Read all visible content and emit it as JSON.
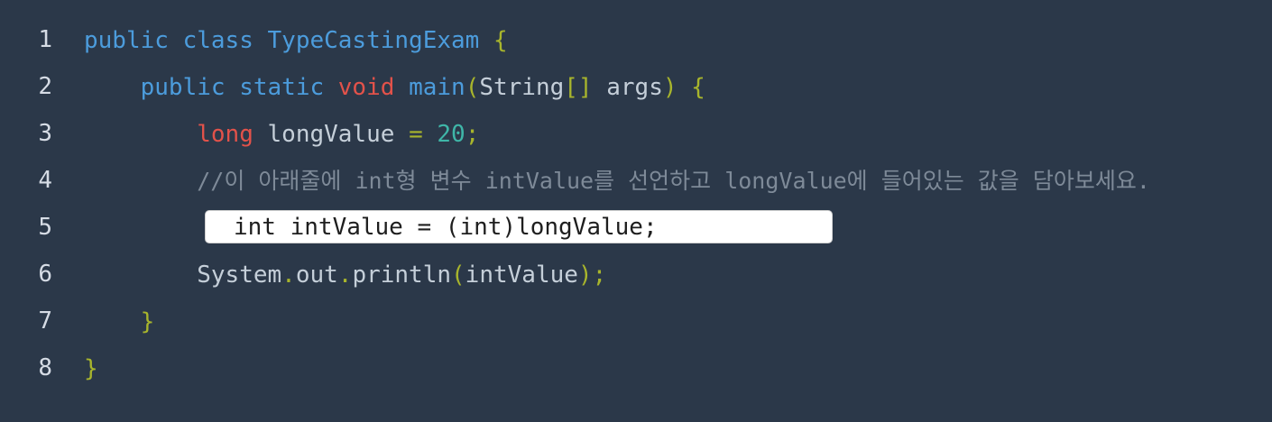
{
  "editor": {
    "line_numbers": [
      "1",
      "2",
      "3",
      "4",
      "5",
      "6",
      "7",
      "8"
    ],
    "line1": {
      "public": "public",
      "class": "class",
      "name": "TypeCastingExam",
      "brace": "{"
    },
    "line2": {
      "public": "public",
      "static": "static",
      "void": "void",
      "main": "main",
      "open_paren": "(",
      "string": "String",
      "brackets": "[]",
      "args": "args",
      "close_paren": ")",
      "brace": "{"
    },
    "line3": {
      "type": "long",
      "var": "longValue",
      "eq": "=",
      "value": "20",
      "semi": ";"
    },
    "line4": {
      "comment": "//이 아래줄에 int형 변수 intValue를 선언하고 longValue에 들어있는 값을 담아보세요."
    },
    "line5": {
      "answer_value": "int intValue = (int)longValue;"
    },
    "line6": {
      "system": "System",
      "dot1": ".",
      "out": "out",
      "dot2": ".",
      "println": "println",
      "open_paren": "(",
      "arg": "intValue",
      "close_paren": ")",
      "semi": ";"
    },
    "line7": {
      "brace": "}"
    },
    "line8": {
      "brace": "}"
    }
  },
  "colors": {
    "background": "#2b3849",
    "keyword_blue": "#4c9cdc",
    "keyword_red": "#e2524a",
    "brace_olive": "#a8b52c",
    "number_teal": "#3fb6a8",
    "comment_gray": "#7e8a98",
    "plain_text": "#c5cfd9"
  }
}
